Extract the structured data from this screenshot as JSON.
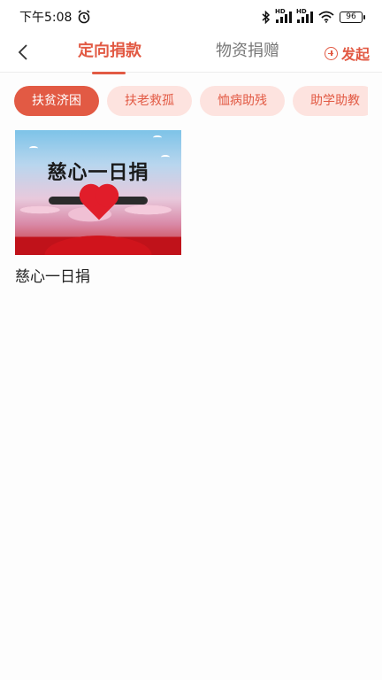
{
  "status_bar": {
    "time": "下午5:08",
    "signal_labels": [
      "HD",
      "HD"
    ],
    "battery": "96"
  },
  "header": {
    "tabs": [
      {
        "label": "定向捐款",
        "active": true
      },
      {
        "label": "物资捐赠",
        "active": false
      }
    ],
    "launch_label": "发起",
    "accent_color": "#e25a44"
  },
  "categories": [
    {
      "label": "扶贫济困",
      "active": true
    },
    {
      "label": "扶老救孤",
      "active": false
    },
    {
      "label": "恤病助残",
      "active": false
    },
    {
      "label": "助学助教",
      "active": false
    }
  ],
  "projects": [
    {
      "title": "慈心一日捐",
      "banner_title": "慈心一日捐"
    }
  ]
}
